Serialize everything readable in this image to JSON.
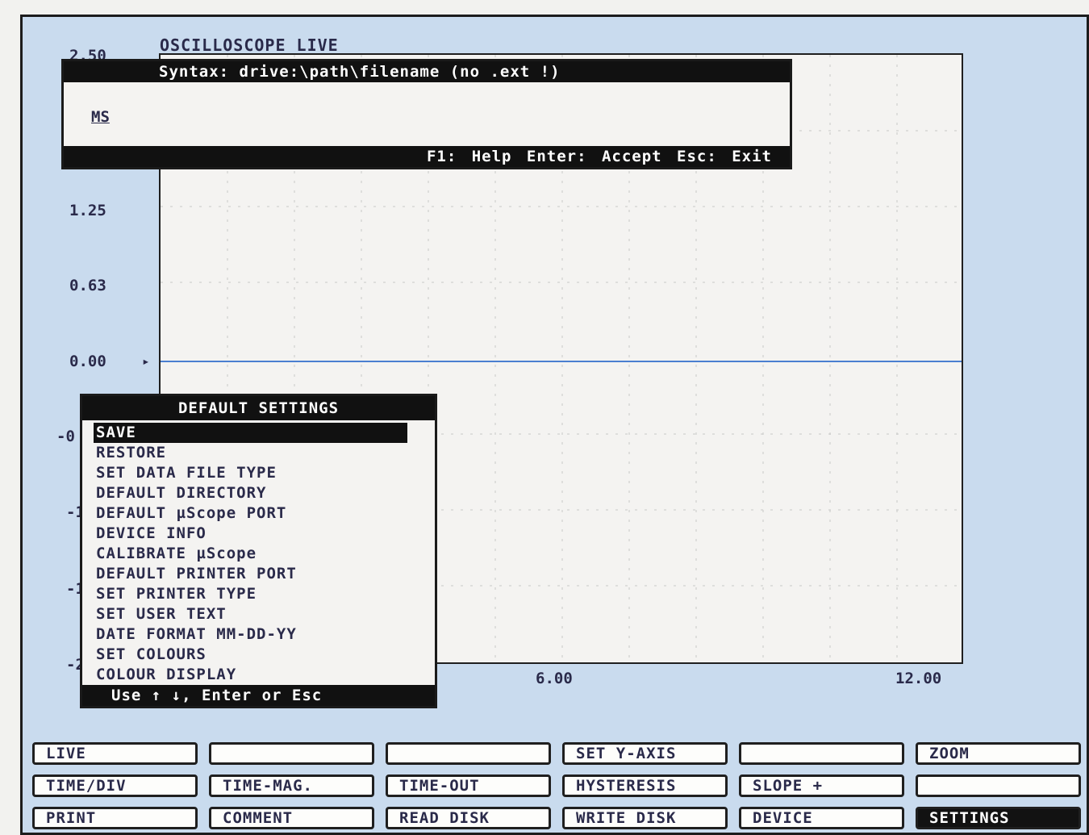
{
  "app": {
    "title": "OSCILLOSCOPE LIVE"
  },
  "y_axis": {
    "ticks": [
      "2.50",
      "1.25",
      "0.63",
      "0.00",
      "-0",
      "-1",
      "-1",
      "-2"
    ]
  },
  "x_axis": {
    "ticks": [
      "6.00",
      "12.00"
    ]
  },
  "trace": {
    "value": 0.0,
    "color": "#4a7fd0"
  },
  "file_dialog": {
    "syntax": "Syntax: drive:\\path\\filename (no .ext !)",
    "input_value": "MS",
    "footer": "F1: Help  Enter: Accept  Esc: Exit"
  },
  "settings_menu": {
    "title": "DEFAULT SETTINGS",
    "items": [
      "SAVE",
      "RESTORE",
      "SET DATA FILE TYPE",
      "DEFAULT DIRECTORY",
      "DEFAULT µScope PORT",
      "DEVICE INFO",
      "CALIBRATE µScope",
      "DEFAULT PRINTER PORT",
      "SET PRINTER TYPE",
      "SET USER TEXT",
      "DATE FORMAT MM-DD-YY",
      "SET COLOURS",
      "COLOUR DISPLAY"
    ],
    "selected": "SAVE",
    "footer": "Use ↑ ↓, Enter or Esc"
  },
  "softkeys": [
    "LIVE",
    "",
    "",
    "SET Y-AXIS",
    "",
    "ZOOM",
    "TIME/DIV",
    "TIME-MAG.",
    "TIME-OUT",
    "HYSTERESIS",
    "SLOPE +",
    "",
    "PRINT",
    "COMMENT",
    "READ DISK",
    "WRITE DISK",
    "DEVICE",
    "SETTINGS"
  ],
  "active_softkey": "SETTINGS"
}
